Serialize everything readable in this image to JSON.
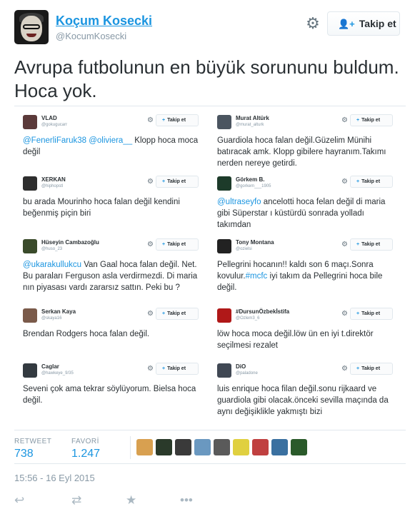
{
  "user": {
    "display_name": "Koçum Kosecki",
    "screen_name": "@KocumKosecki",
    "follow_label": "Takip et"
  },
  "tweet": {
    "text": "Avrupa futbolunun en büyük sorununu buldum. Hoca yok."
  },
  "embedded_tweets": [
    {
      "name": "VLAD",
      "screen": "@gokugucarr",
      "follow": "Takip et",
      "mention": "@FenerliFaruk38 @oliviera__",
      "body": " Klopp hoca moca değil",
      "avatar_color": "#5b3a3a"
    },
    {
      "name": "Murat Altürk",
      "screen": "@murat_alturk",
      "follow": "Takip et",
      "mention": "",
      "body": "Guardiola hoca falan değil.Güzelim Münihi batıracak amk. Klopp gibilere hayranım.Takımı nerden nereye getirdi.",
      "avatar_color": "#4b5560"
    },
    {
      "name": "XERKAN",
      "screen": "@hiphopstl",
      "follow": "Takip et",
      "mention": "",
      "body": "bu arada Mourinho hoca falan değil kendini beğenmiş piçin biri",
      "avatar_color": "#2e2e2e"
    },
    {
      "name": "Görkem B.",
      "screen": "@gorkem___1905",
      "follow": "Takip et",
      "mention": "@ultraseyfo",
      "body": " ancelotti hoca felan değil di maria gibi Süperstar ı küstürdü sonrada yolladı takımdan",
      "avatar_color": "#1d3b2a"
    },
    {
      "name": "Hüseyin Cambazoğlu",
      "screen": "@huso_23",
      "follow": "Takip et",
      "mention": "@ukarakullukcu",
      "body": " Van Gaal hoca falan değil. Net. Bu paraları Ferguson asla verdirmezdi. Di maria nın piyasası vardı zararsız sattın. Peki bu ?",
      "avatar_color": "#3a4a2a"
    },
    {
      "name": "Tony Montana",
      "screen": "@ozielsi",
      "follow": "Takip et",
      "mention": "",
      "body": "Pellegrini hocanın!! kaldı son 6 maçı.Sonra kovulur.",
      "tag": "#mcfc",
      "body2": " iyi takım da Pellegrini hoca bile değil.",
      "avatar_color": "#222222"
    },
    {
      "name": "Serkan Kaya",
      "screen": "@skaya16",
      "follow": "Takip et",
      "mention": "",
      "body": "Brendan Rodgers hoca falan değil.",
      "avatar_color": "#7a5a4a"
    },
    {
      "name": "#DursunÖzbekİstifa",
      "screen": "@Ozlem3_6",
      "follow": "Takip et",
      "mention": "",
      "body": "löw hoca moca değil.löw ün en iyi t.direktör seçilmesi rezalet",
      "avatar_color": "#b01818"
    },
    {
      "name": "Caglar",
      "screen": "@hawkeye_9/35",
      "follow": "Takip et",
      "mention": "",
      "body": "Seveni çok ama tekrar söylüyorum. Bielsa hoca değil.",
      "avatar_color": "#333a40"
    },
    {
      "name": "DiO",
      "screen": "@paladone",
      "follow": "Takip et",
      "mention": "",
      "body": "luis enrique hoca filan değil.sonu rijkaard ve guardiola gibi olacak.önceki sevilla maçında da aynı değişiklikle yakmıştı bizi",
      "avatar_color": "#404854"
    }
  ],
  "stats": {
    "retweet_label": "RETWEET",
    "retweet_count": "738",
    "favorite_label": "FAVORİ",
    "favorite_count": "1.247"
  },
  "favoriters": [
    {
      "color": "#d8a050"
    },
    {
      "color": "#2a3a2a"
    },
    {
      "color": "#3a3a3a"
    },
    {
      "color": "#6a98c0"
    },
    {
      "color": "#5a5a5a"
    },
    {
      "color": "#e0d040"
    },
    {
      "color": "#c04040"
    },
    {
      "color": "#3a70a0"
    },
    {
      "color": "#2a5a2a"
    }
  ],
  "timestamp": "15:56 - 16 Eyl 2015",
  "icons": {
    "reply": "reply-icon",
    "retweet": "retweet-icon",
    "favorite": "star-icon",
    "more": "more-icon",
    "gear": "gear-icon"
  }
}
